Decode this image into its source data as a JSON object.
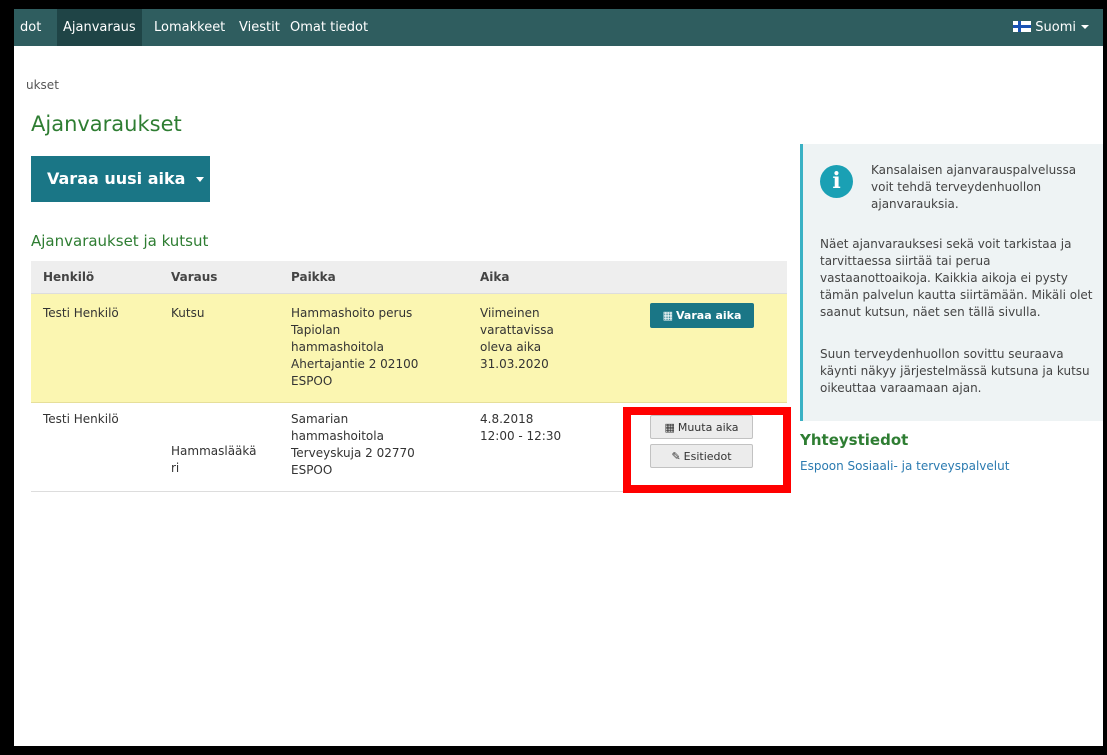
{
  "nav": {
    "items": [
      "dot",
      "Ajanvaraus",
      "Lomakkeet",
      "Viestit",
      "Omat tiedot"
    ],
    "language": "Suomi"
  },
  "breadcrumb": "ukset",
  "page_title": "Ajanvaraukset",
  "new_button": "Varaa uusi aika",
  "section_title": "Ajanvaraukset ja kutsut",
  "table": {
    "headers": [
      "Henkilö",
      "Varaus",
      "Paikka",
      "Aika"
    ],
    "rows": [
      {
        "person": "Testi Henkilö",
        "type": "Kutsu",
        "place": [
          "Hammashoito perus",
          "Tapiolan",
          "hammashoitola",
          "Ahertajantie 2 02100",
          "ESPOO"
        ],
        "time": [
          "Viimeinen",
          "varattavissa",
          "oleva aika",
          "31.03.2020"
        ],
        "action": "Varaa aika"
      },
      {
        "person": "Testi Henkilö",
        "type": [
          "Hammaslääkä",
          "ri"
        ],
        "place": [
          "Samarian",
          "hammashoitola",
          "Terveyskuja 2 02770",
          "ESPOO"
        ],
        "time": [
          "4.8.2018",
          "12:00 - 12:30"
        ],
        "action1": "Muuta aika",
        "action2": "Esitiedot"
      }
    ]
  },
  "info": {
    "lead": "Kansalaisen ajanvarauspalvelussa voit tehdä terveydenhuollon ajanvarauksia.",
    "p1": "Näet ajanvarauksesi sekä voit tarkistaa ja tarvittaessa siirtää tai perua vastaanottoaikoja. Kaikkia aikoja ei pysty tämän palvelun kautta siirtämään. Mikäli olet saanut kutsun, näet sen tällä sivulla.",
    "p2": "Suun terveydenhuollon sovittu seuraava käynti näkyy järjestelmässä kutsuna ja kutsu oikeuttaa varaamaan ajan."
  },
  "contact": {
    "title": "Yhteystiedot",
    "link": "Espoon Sosiaali- ja terveyspalvelut"
  },
  "colors": {
    "nav_bg": "#2f5d5f",
    "accent_teal": "#1a7686",
    "title_green": "#2e7d32",
    "highlight_row": "#fbf6b1",
    "annotation_red": "#ff0000"
  }
}
